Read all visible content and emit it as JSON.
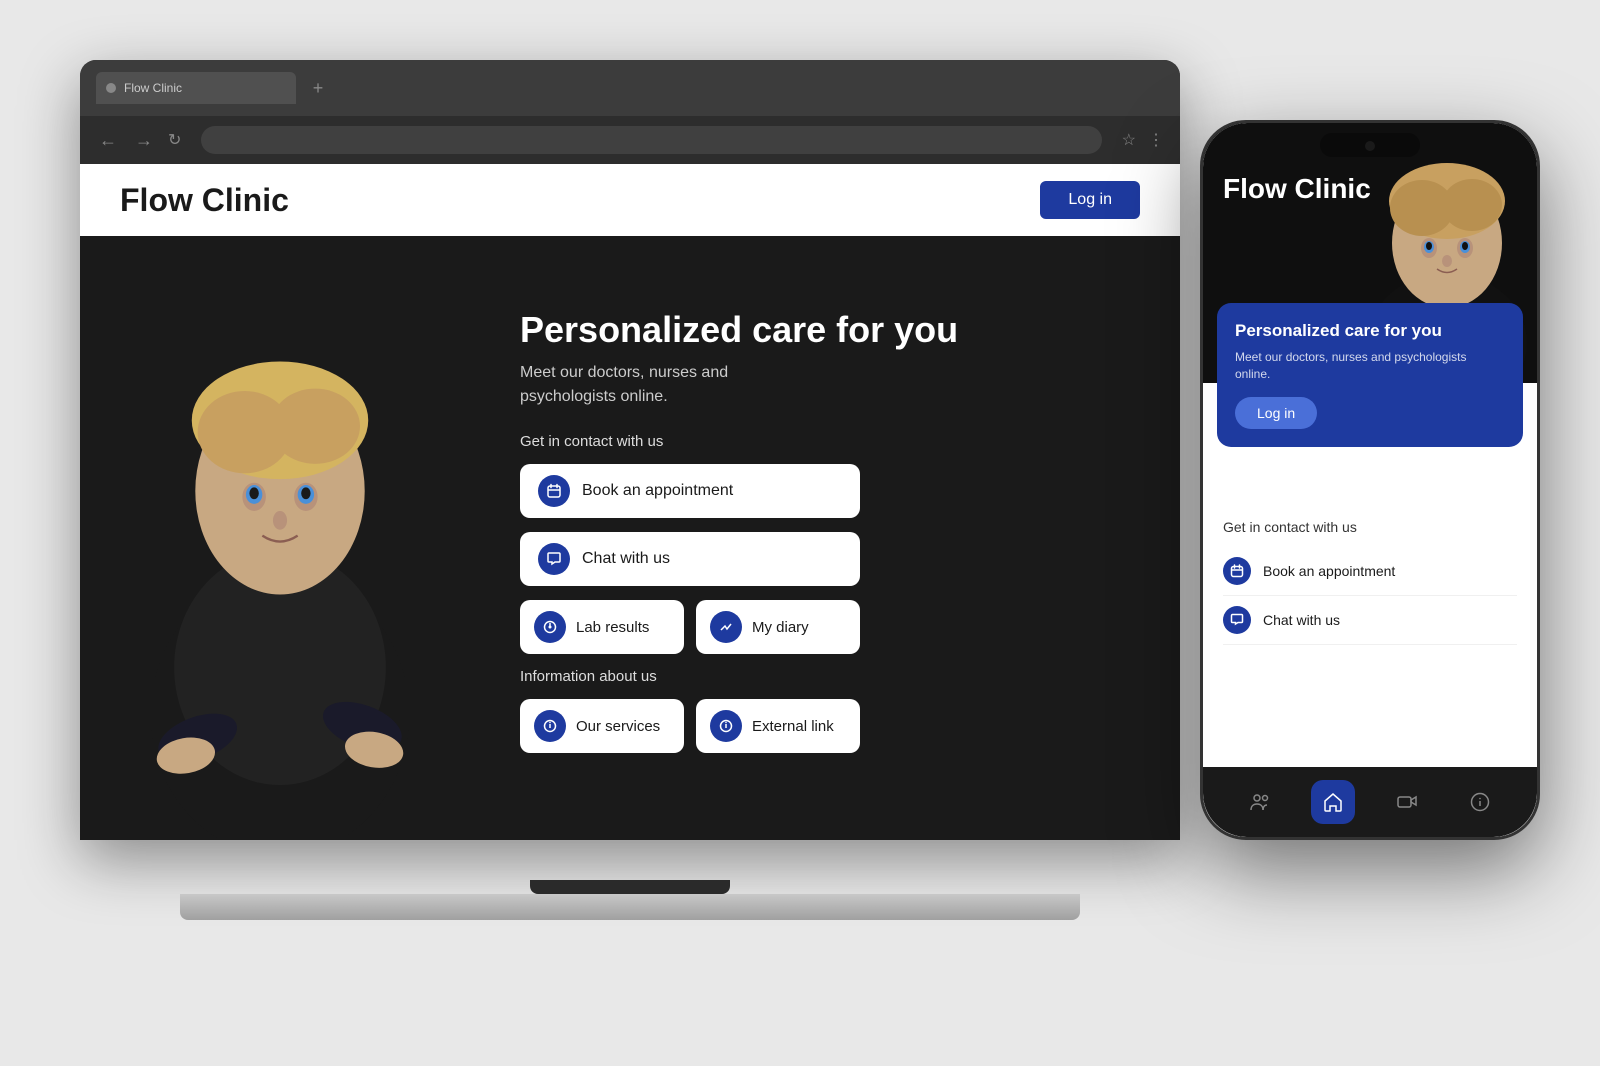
{
  "scene": {
    "background": "#e8e8e8"
  },
  "laptop": {
    "browser": {
      "tab_title": "Flow Clinic",
      "tab_close": "×",
      "tab_add": "+"
    },
    "website": {
      "logo": "Flow Clinic",
      "login_button": "Log in",
      "hero": {
        "title": "Personalized care for you",
        "subtitle_line1": "Meet our doctors, nurses and",
        "subtitle_line2": "psychologists online.",
        "contact_label": "Get in contact with us",
        "book_appointment": "Book an appointment",
        "chat_with_us": "Chat with us",
        "lab_results": "Lab results",
        "my_diary": "My diary",
        "info_label": "Information about us",
        "our_services": "Our services",
        "external_link": "External link"
      }
    }
  },
  "phone": {
    "logo": "Flow Clinic",
    "card": {
      "title": "Personalized care for you",
      "subtitle": "Meet our doctors, nurses and psychologists online.",
      "login_button": "Log in"
    },
    "contact": {
      "label": "Get in contact with us",
      "book_appointment": "Book an appointment",
      "chat_with_us": "Chat with us"
    },
    "bottom_nav": {
      "icons": [
        "people",
        "home",
        "video",
        "info"
      ]
    }
  }
}
